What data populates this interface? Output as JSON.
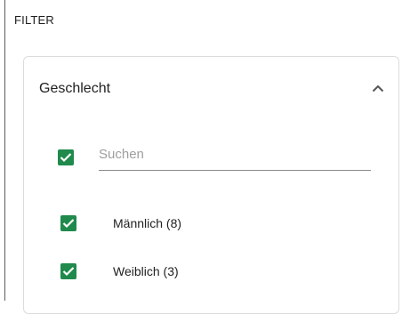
{
  "filter": {
    "heading": "FILTER"
  },
  "facet": {
    "title": "Geschlecht",
    "expanded": true,
    "search": {
      "placeholder": "Suchen",
      "value": "",
      "select_all_checked": true
    },
    "options": [
      {
        "label": "Männlich (8)",
        "checked": true
      },
      {
        "label": "Weiblich (3)",
        "checked": true
      }
    ]
  },
  "colors": {
    "checkbox": "#1f8a4c",
    "border": "#dcdcdc"
  }
}
